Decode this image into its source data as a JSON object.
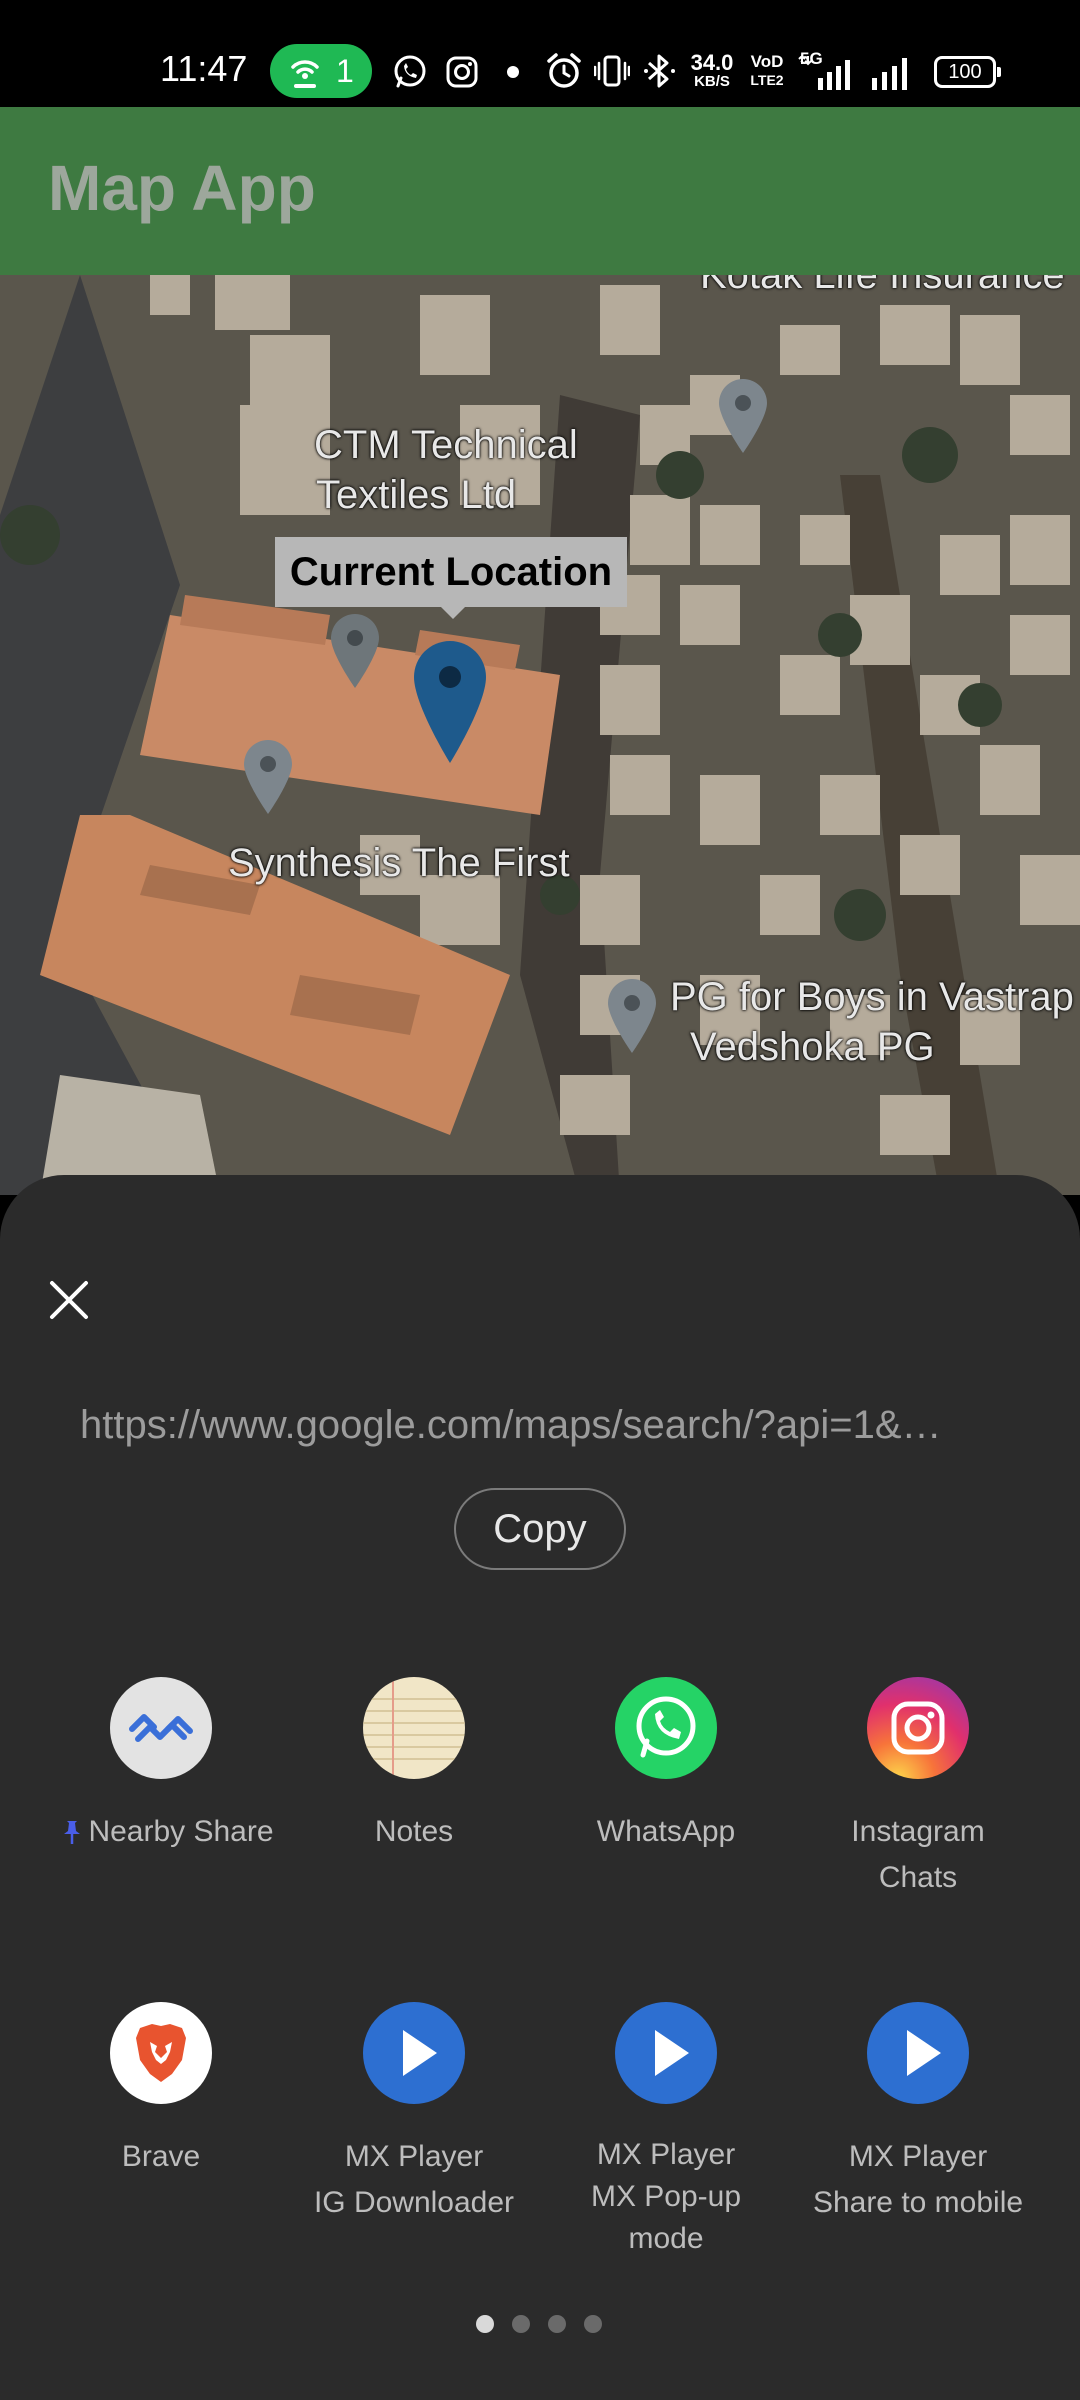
{
  "status_bar": {
    "time": "11:47",
    "hotspot_count": "1",
    "net_speed_value": "34.0",
    "net_speed_unit": "KB/S",
    "volte_top": "Vo",
    "volte_bottom": "LTE",
    "volte_sim": "2",
    "volte_top_sup": "D",
    "network_type": "5G",
    "battery": "100"
  },
  "app_bar": {
    "title": "Map App"
  },
  "map": {
    "labels": {
      "ctm_line1": "CTM Technical",
      "ctm_line2": "Textiles Ltd",
      "synthesis": "Synthesis The First",
      "pg_line1": "PG for Boys in Vastrap",
      "pg_line2": "Vedshoka PG",
      "kotak": "Kotak Life Insurance"
    },
    "callout": "Current Location"
  },
  "share_sheet": {
    "url": "https://www.google.com/maps/search/?api=1&…",
    "copy_label": "Copy",
    "targets": [
      {
        "label1": "Nearby Share",
        "label2": ""
      },
      {
        "label1": "Notes",
        "label2": ""
      },
      {
        "label1": "WhatsApp",
        "label2": ""
      },
      {
        "label1": "Instagram",
        "label2": "Chats"
      },
      {
        "label1": "Brave",
        "label2": ""
      },
      {
        "label1": "MX Player",
        "label2": "IG Downloader"
      },
      {
        "label1": "MX Player",
        "label2": "MX Pop-up",
        "label3": "mode"
      },
      {
        "label1": "MX Player",
        "label2": "Share to mobile"
      }
    ],
    "pager": {
      "pages": 4,
      "current": 1
    }
  },
  "colors": {
    "app_bar": "#3e7a41",
    "sheet_bg": "#2b2b2b",
    "hotspot_pill": "#1fb954",
    "marker_current": "#1e5a8c",
    "whatsapp": "#25d366",
    "mx_player": "#2d6fd1"
  }
}
